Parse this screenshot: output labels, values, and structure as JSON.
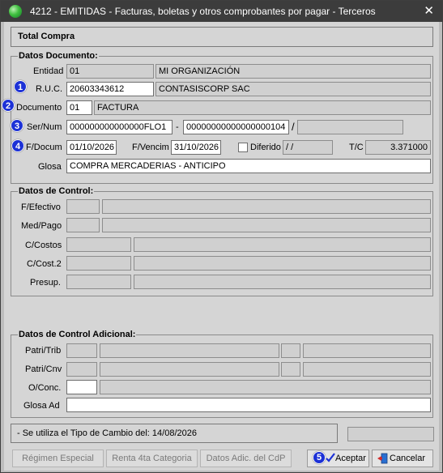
{
  "window": {
    "title": "4212 - EMITIDAS - Facturas, boletas y otros comprobantes por pagar - Terceros",
    "close_glyph": "✕"
  },
  "header": {
    "label": "Total Compra"
  },
  "datos_documento": {
    "title": "Datos Documento:",
    "entidad": {
      "label": "Entidad",
      "code": "01",
      "name": "MI ORGANIZACIÓN"
    },
    "ruc": {
      "badge": "1",
      "label": "R.U.C.",
      "value": "20603343612",
      "name": "CONTASISCORP SAC"
    },
    "documento": {
      "badge": "2",
      "label": "Documento",
      "code": "01",
      "name": "FACTURA"
    },
    "sernum": {
      "badge": "3",
      "label": "Ser/Num",
      "serie": "000000000000000FLO1",
      "dash": "-",
      "numero": "00000000000000000104",
      "slash": "/",
      "extra": ""
    },
    "fechas": {
      "badge": "4",
      "label_docum": "F/Docum",
      "docum": "01/10/2026",
      "label_vencim": "F/Vencim",
      "vencim": "31/10/2026",
      "label_diferido": "Diferido",
      "diferido": " /  /",
      "label_tc": "T/C",
      "tc": "3.371000"
    },
    "glosa": {
      "label": "Glosa",
      "value": "COMPRA MERCADERIAS - ANTICIPO"
    }
  },
  "datos_control": {
    "title": "Datos de Control:",
    "rows": [
      {
        "label": "F/Efectivo"
      },
      {
        "label": "Med/Pago"
      },
      {
        "label": "C/Costos"
      },
      {
        "label": "C/Cost.2"
      },
      {
        "label": "Presup."
      }
    ]
  },
  "datos_control_adicional": {
    "title": "Datos de Control Adicional:",
    "patri_trib": {
      "label": "Patri/Trib"
    },
    "patri_cnv": {
      "label": "Patri/Cnv"
    },
    "oconc": {
      "label": "O/Conc."
    },
    "glosa_ad": {
      "label": "Glosa Ad"
    }
  },
  "status": {
    "message": "- Se utiliza el Tipo de Cambio del: 14/08/2026"
  },
  "buttons": {
    "regimen": "Régimen Especial",
    "renta": "Renta 4ta Categoria",
    "adic": "Datos Adic. del CdP",
    "aceptar_badge": "5",
    "aceptar": "Aceptar",
    "cancelar": "Cancelar"
  },
  "colors": {
    "badge": "#1c31d6",
    "titlebar": "#3c3c3c",
    "client": "#d5d5d5"
  }
}
